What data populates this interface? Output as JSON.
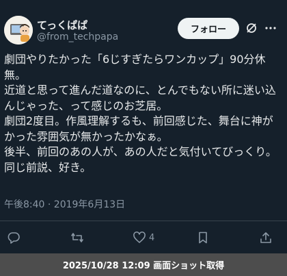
{
  "tweet": {
    "display_name": "てっくぱぱ",
    "handle": "@from_techpapa",
    "text": "劇団やりたかった「6じすぎたらワンカップ」90分休無。\n近道と思って進んだ道なのに、とんでもない所に迷い込んじゃった、って感じのお芝居。\n劇団2度目。作風理解するも、前回感じた、舞台に神がかった雰囲気が無かったかなぁ。\n後半、前回のあの人が、あの人だと気付いてびっくり。同じ前説、好き。",
    "timestamp": "午後8:40 · 2019年6月13日",
    "like_count": "4"
  },
  "header": {
    "follow_label": "フォロー",
    "icons": [
      "grok-icon",
      "more-icon"
    ]
  },
  "actions": {
    "icons": [
      "reply-icon",
      "retweet-icon",
      "like-icon",
      "bookmark-icon",
      "share-icon"
    ]
  },
  "banner": {
    "text": "2025/10/28 12:09 画面ショット取得"
  },
  "colors": {
    "background": "#15202b",
    "text": "#e7e9ea",
    "secondary": "#8b98a5",
    "follow_bg": "#eff3f4",
    "banner_bg": "#4d4d4d"
  }
}
